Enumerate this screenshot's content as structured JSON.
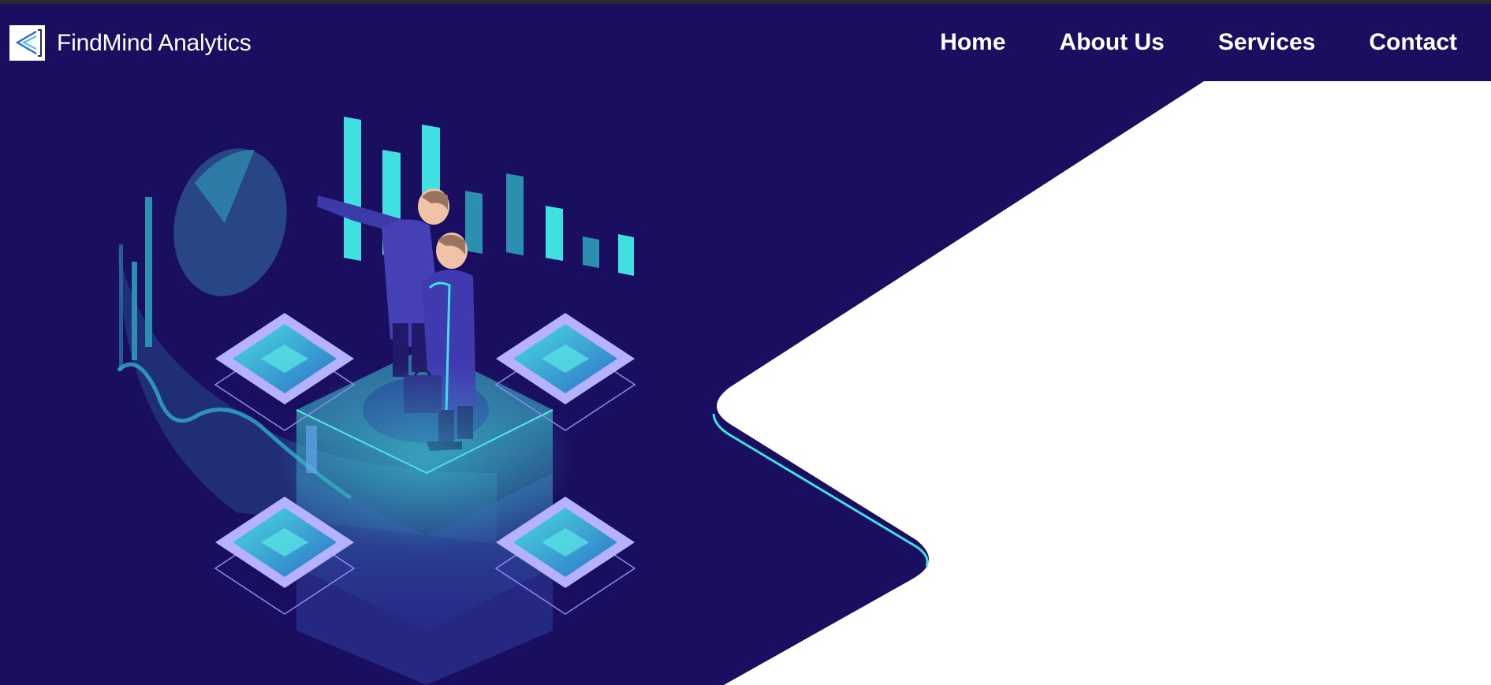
{
  "brand": {
    "logo_icon": "findmind-logo-icon",
    "name": "FindMind Analytics"
  },
  "nav": {
    "items": [
      {
        "label": "Home"
      },
      {
        "label": "About Us"
      },
      {
        "label": "Services"
      },
      {
        "label": "Contact"
      }
    ]
  },
  "hero": {
    "illustration": "isometric-analytics-illustration",
    "icons": [
      "pie-chart-icon",
      "bar-chart-icon",
      "businessmen-figure-icon",
      "server-platform-icon",
      "chip-tile-icon",
      "briefcase-icon"
    ]
  },
  "colors": {
    "background": "#190e5f",
    "panel": "#ffffff",
    "accent_cyan": "#3fe0df",
    "accent_purple": "#8f89f0",
    "text": "#ffffff"
  }
}
